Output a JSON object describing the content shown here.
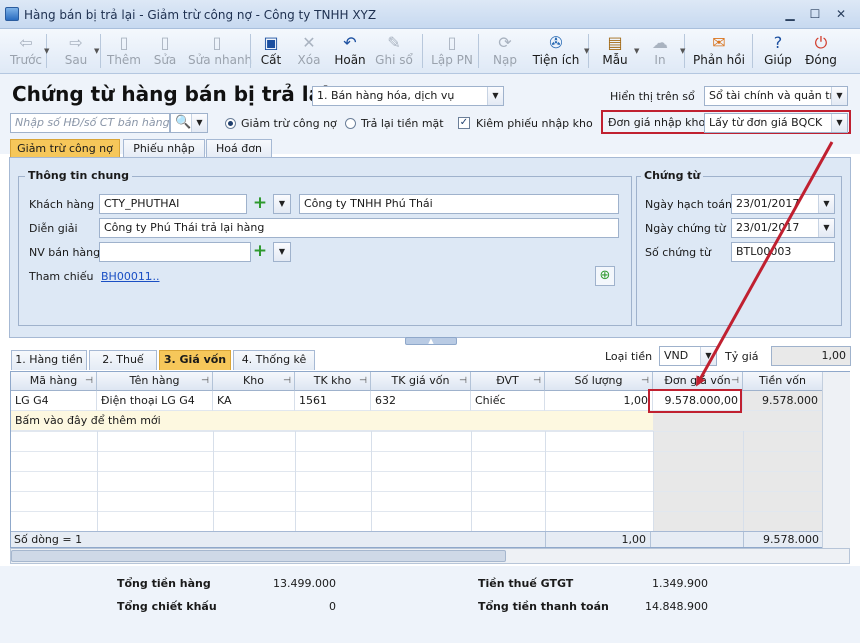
{
  "window": {
    "title": "Hàng bán bị trả lại - Giảm trừ công nợ - Công ty TNHH XYZ"
  },
  "toolbar": [
    {
      "label": "Trước",
      "icon": "arrow-left-icon",
      "glyph": "⇦",
      "enabled": false
    },
    {
      "label": "Sau",
      "icon": "arrow-right-icon",
      "glyph": "⇨",
      "enabled": false
    },
    {
      "label": "Thêm",
      "icon": "document-add-icon",
      "glyph": "▯",
      "enabled": false
    },
    {
      "label": "Sửa",
      "icon": "document-edit-icon",
      "glyph": "▯",
      "enabled": false
    },
    {
      "label": "Sửa nhanh",
      "icon": "quick-edit-icon",
      "glyph": "▯",
      "enabled": false
    },
    {
      "label": "Cất",
      "icon": "save-icon",
      "glyph": "▣",
      "enabled": true
    },
    {
      "label": "Xóa",
      "icon": "delete-icon",
      "glyph": "✕",
      "enabled": false
    },
    {
      "label": "Hoãn",
      "icon": "undo-icon",
      "glyph": "↶",
      "enabled": true
    },
    {
      "label": "Ghi sổ",
      "icon": "post-ledger-icon",
      "glyph": "✎",
      "enabled": false
    },
    {
      "label": "Lập PN",
      "icon": "create-receipt-icon",
      "glyph": "▯",
      "enabled": false
    },
    {
      "label": "Nạp",
      "icon": "reload-icon",
      "glyph": "⟳",
      "enabled": false
    },
    {
      "label": "Tiện ích",
      "icon": "utilities-icon",
      "glyph": "✇",
      "enabled": true
    },
    {
      "label": "Mẫu",
      "icon": "template-icon",
      "glyph": "▤",
      "enabled": true
    },
    {
      "label": "In",
      "icon": "print-icon",
      "glyph": "☁",
      "enabled": false
    },
    {
      "label": "Phản hồi",
      "icon": "feedback-icon",
      "glyph": "✉",
      "enabled": true
    },
    {
      "label": "Giúp",
      "icon": "help-icon",
      "glyph": "?",
      "enabled": true
    },
    {
      "label": "Đóng",
      "icon": "close-icon",
      "glyph": "⏻",
      "enabled": true
    }
  ],
  "header": {
    "title": "Chứng từ hàng bán bị trả lại",
    "type_select": "1. Bán hàng hóa, dịch vụ",
    "display_label": "Hiển thị trên sổ",
    "display_value": "Sổ tài chính và quản trị",
    "search_placeholder": "Nhập số HĐ/số CT bán hàng",
    "radio_reduce": "Giảm trừ công nợ",
    "radio_refund": "Trả lại tiền mặt",
    "check_receipt": "Kiêm phiếu nhập kho",
    "unit_price_label": "Đơn giá nhập kho",
    "unit_price_value": "Lấy từ đơn giá BQCK"
  },
  "tabs": [
    "Giảm trừ công nợ",
    "Phiếu nhập",
    "Hoá đơn"
  ],
  "general": {
    "title": "Thông tin chung",
    "customer_label": "Khách hàng",
    "customer_code": "CTY_PHUTHAI",
    "customer_name": "Công ty TNHH Phú Thái",
    "desc_label": "Diễn giải",
    "desc_value": "Công ty Phú Thái trả lại hàng",
    "sales_label": "NV bán hàng",
    "ref_label": "Tham chiếu",
    "ref_link": "BH00011",
    "ref_more": "..."
  },
  "voucher": {
    "title": "Chứng từ",
    "post_date_label": "Ngày hạch toán",
    "post_date": "23/01/2017",
    "doc_date_label": "Ngày chứng từ",
    "doc_date": "23/01/2017",
    "doc_no_label": "Số chứng từ",
    "doc_no": "BTL00003"
  },
  "bottom_tabs": [
    "1. Hàng tiền",
    "2. Thuế",
    "3. Giá vốn",
    "4. Thống kê"
  ],
  "currency": {
    "label": "Loại tiền",
    "value": "VND",
    "rate_label": "Tỷ giá",
    "rate_value": "1,00"
  },
  "grid": {
    "columns": [
      "Mã hàng",
      "Tên hàng",
      "Kho",
      "TK kho",
      "TK giá vốn",
      "ĐVT",
      "Số lượng",
      "Đơn giá vốn",
      "Tiền vốn"
    ],
    "rows": [
      [
        "LG G4",
        "Điện thoại LG G4",
        "KA",
        "1561",
        "632",
        "Chiếc",
        "1,00",
        "9.578.000,00",
        "9.578.000"
      ]
    ],
    "add_hint": "Bấm vào đây để thêm mới",
    "footer": {
      "count": "Số dòng = 1",
      "qty_total": "1,00",
      "amount_total": "9.578.000"
    }
  },
  "totals": {
    "goods_label": "Tổng tiền hàng",
    "goods_value": "13.499.000",
    "discount_label": "Tổng chiết khấu",
    "discount_value": "0",
    "vat_label": "Tiền thuế GTGT",
    "vat_value": "1.349.900",
    "payment_label": "Tổng tiền thanh toán",
    "payment_value": "14.848.900"
  },
  "colors": {
    "accent": "#f6c75a",
    "highlight": "#c02030",
    "link": "#1a4fc4"
  }
}
